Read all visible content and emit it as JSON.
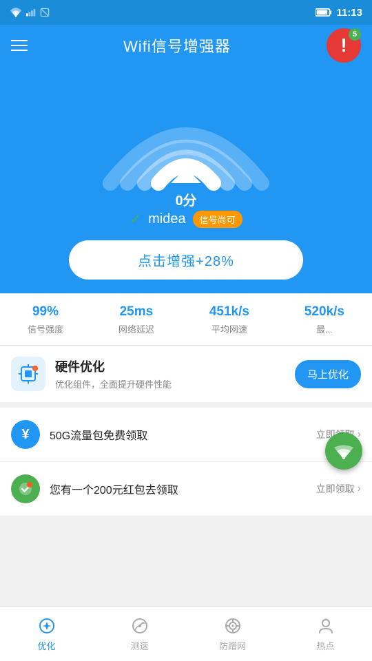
{
  "statusBar": {
    "time": "11:13",
    "wifiIcon": "wifi",
    "signalIcon": "signal",
    "batteryIcon": "battery"
  },
  "header": {
    "title": "Wifi信号增强器",
    "menuIcon": "hamburger-menu",
    "notifIcon": "exclamation",
    "notifBadge": "5"
  },
  "wifiSection": {
    "score": "0分",
    "networkName": "midea",
    "signalStatus": "信号尚可",
    "boostLabel": "点击增强+28%"
  },
  "stats": [
    {
      "value": "99%",
      "label": "信号强度"
    },
    {
      "value": "25ms",
      "label": "网络延迟"
    },
    {
      "value": "451k/s",
      "label": "平均网速"
    },
    {
      "value": "520k/s",
      "label": "最..."
    }
  ],
  "hardwareCard": {
    "title": "硬件优化",
    "desc": "优化组件，全面提升硬件性能",
    "btnLabel": "马上优化"
  },
  "listItems": [
    {
      "iconColor": "blue",
      "iconSymbol": "¥",
      "text": "50G流量包免费领取",
      "action": "立即领取"
    },
    {
      "iconColor": "green",
      "iconSymbol": "✓",
      "text": "您有一个200元红包去领取",
      "action": "立即领取"
    }
  ],
  "bottomNav": [
    {
      "label": "优化",
      "icon": "bell",
      "active": true
    },
    {
      "label": "测速",
      "icon": "gauge",
      "active": false
    },
    {
      "label": "防蹭网",
      "icon": "target",
      "active": false
    },
    {
      "label": "热点",
      "icon": "hotspot",
      "active": false
    }
  ]
}
